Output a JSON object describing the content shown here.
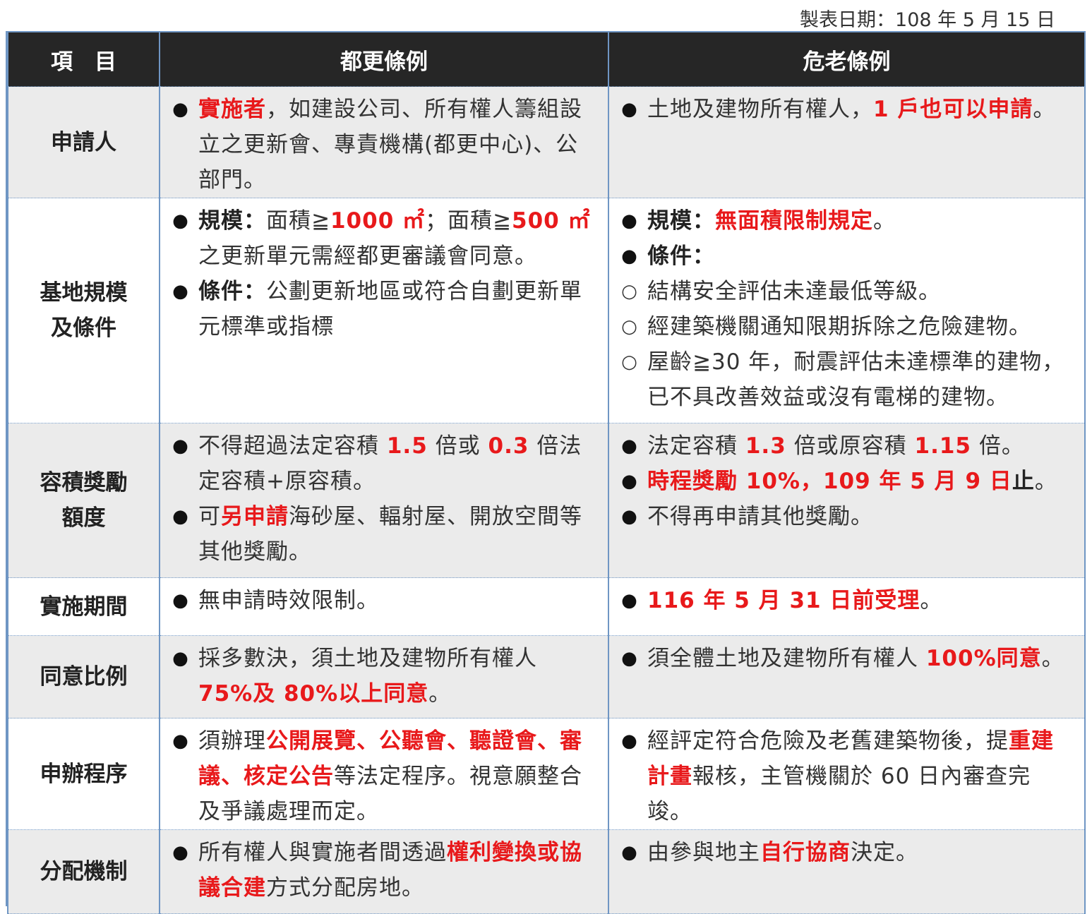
{
  "header": {
    "date": "製表日期：108 年 5 月 15 日"
  },
  "columns": {
    "item": "項　目",
    "urban": "都更條例",
    "danger": "危老條例"
  },
  "rows": {
    "applicant": {
      "label": "申請人",
      "urban": [
        {
          "p1": "實施者",
          "p2": "，如建設公司、所有權人籌組設立之更新會、專責機構(都更中心)、公部門。"
        }
      ],
      "danger": [
        {
          "p1": "土地及建物所有權人，",
          "p2": "1 戶也可以申請",
          "p3": "。"
        }
      ]
    },
    "scale": {
      "label1": "基地規模",
      "label2": "及條件",
      "urban": [
        {
          "p1": "規模：",
          "p2": "面積≧",
          "p3": "1000 ㎡",
          "p4": "；面積≧",
          "p5": "500 ㎡",
          "p6": "之更新單元需經都更審議會同意。"
        },
        {
          "p1": "條件：",
          "p2": "公劃更新地區或符合自劃更新單元標準或指標"
        }
      ],
      "danger": [
        {
          "p1": "規模：",
          "p2": "無面積限制規定",
          "p3": "。"
        },
        {
          "p1": "條件："
        },
        {
          "p1": "結構安全評估未達最低等級。"
        },
        {
          "p1": "經建築機關通知限期拆除之危險建物。"
        },
        {
          "p1": "屋齡≧30 年，耐震評估未達標準的建物，已不具改善效益或沒有電梯的建物。"
        }
      ]
    },
    "far": {
      "label1": "容積獎勵",
      "label2": "額度",
      "urban": [
        {
          "p1": "不得超過法定容積 ",
          "p2": "1.5",
          "p3": " 倍或 ",
          "p4": "0.3",
          "p5": " 倍法定容積+原容積。"
        },
        {
          "p1": "可",
          "p2": "另申請",
          "p3": "海砂屋、輻射屋、開放空間等其他獎勵。"
        }
      ],
      "danger": [
        {
          "p1": "法定容積 ",
          "p2": "1.3",
          "p3": " 倍或原容積 ",
          "p4": "1.15",
          "p5": " 倍。"
        },
        {
          "p1": "時程獎勵 10%，109 年 5 月 9 日",
          "p2": "止",
          "p3": "。"
        },
        {
          "p1": "不得再申請其他獎勵。"
        }
      ]
    },
    "period": {
      "label": "實施期間",
      "urban": [
        {
          "p1": "無申請時效限制。"
        }
      ],
      "danger": [
        {
          "p1": "116 年 5 月 31 日前受理",
          "p2": "。"
        }
      ]
    },
    "consent": {
      "label": "同意比例",
      "urban": [
        {
          "p1": "採多數決，須土地及建物所有權人 ",
          "p2": "75%及 80%以上同意",
          "p3": "。"
        }
      ],
      "danger": [
        {
          "p1": "須全體土地及建物所有權人 ",
          "p2": "100%同意",
          "p3": "。"
        }
      ]
    },
    "procedure": {
      "label": "申辦程序",
      "urban": [
        {
          "p1": "須辦理",
          "p2": "公開展覽、公聽會、聽證會、審議、核定公告",
          "p3": "等法定程序。視意願整合及爭議處理而定。"
        }
      ],
      "danger": [
        {
          "p1": "經評定符合危險及老舊建築物後，提",
          "p2": "重建計畫",
          "p3": "報核，主管機關於 60 日內審查完竣。"
        }
      ]
    },
    "distribution": {
      "label": "分配機制",
      "urban": [
        {
          "p1": "所有權人與實施者間透過",
          "p2": "權利變換或協議合建",
          "p3": "方式分配房地。"
        }
      ],
      "danger": [
        {
          "p1": "由參與地主",
          "p2": "自行協商",
          "p3": "決定。"
        }
      ]
    }
  }
}
